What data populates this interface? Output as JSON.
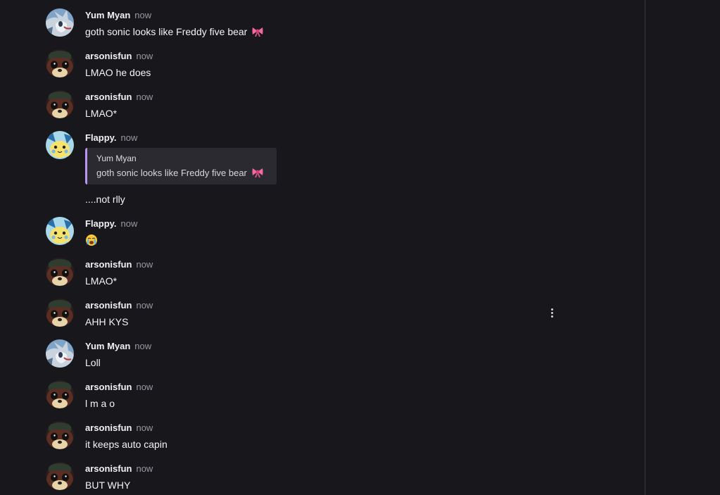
{
  "messages": [
    {
      "author": "Yum Myan",
      "time": "now",
      "text": "goth sonic looks like Freddy five bear",
      "avatar": "sonic-avatar-icon",
      "emoji": "ribbon-emoji"
    },
    {
      "author": "arsonisfun",
      "time": "now",
      "text": "LMAO he does",
      "avatar": "villager-avatar-icon"
    },
    {
      "author": "arsonisfun",
      "time": "now",
      "text": "LMAO*",
      "avatar": "villager-avatar-icon"
    },
    {
      "author": "Flappy.",
      "time": "now",
      "text": "....not rlly",
      "avatar": "pikachu-avatar-icon",
      "reply": {
        "author": "Yum Myan",
        "text": "goth sonic looks like Freddy five bear",
        "emoji": "ribbon-emoji"
      }
    },
    {
      "author": "Flappy.",
      "time": "now",
      "text": "",
      "avatar": "pikachu-avatar-icon",
      "emoji": "loudly-crying-emoji"
    },
    {
      "author": "arsonisfun",
      "time": "now",
      "text": "LMAO*",
      "avatar": "villager-avatar-icon"
    },
    {
      "author": "arsonisfun",
      "time": "now",
      "text": "AHH KYS",
      "avatar": "villager-avatar-icon"
    },
    {
      "author": "Yum Myan",
      "time": "now",
      "text": "Loll",
      "avatar": "sonic-avatar-icon"
    },
    {
      "author": "arsonisfun",
      "time": "now",
      "text": "l m a o",
      "avatar": "villager-avatar-icon"
    },
    {
      "author": "arsonisfun",
      "time": "now",
      "text": "it keeps auto capin",
      "avatar": "villager-avatar-icon"
    },
    {
      "author": "arsonisfun",
      "time": "now",
      "text": "BUT WHY",
      "avatar": "villager-avatar-icon"
    }
  ],
  "colors": {
    "background": "#18171c",
    "reply_accent": "#b794f6",
    "reply_background": "#2b2a31",
    "timestamp": "#9a99a1"
  },
  "message_actions_icon": "vertical-ellipsis-icon"
}
